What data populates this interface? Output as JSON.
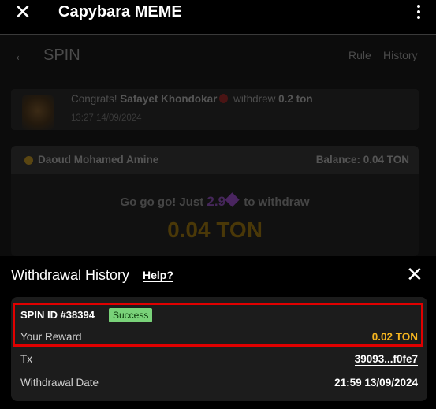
{
  "appbar": {
    "title": "Capybara MEME",
    "close_icon": "close-icon",
    "menu_icon": "more-vertical-icon"
  },
  "spin_page": {
    "title": "SPIN",
    "back_icon": "arrow-left-icon",
    "rule_label": "Rule",
    "history_label": "History",
    "congrats": {
      "prefix": "Congrats!",
      "name": "Safayet Khondokar",
      "emoji_icon": "strawberry-icon",
      "action": "withdrew",
      "amount": "0.2 ton",
      "timestamp": "13:27 14/09/2024"
    },
    "card": {
      "user_icon": "coin-icon",
      "user_name": "Daoud Mohamed Amine",
      "balance": "Balance: 0.04 TON",
      "message_prefix": "Go go go! Just",
      "message_number": "2.9",
      "gem_icon": "gem-icon",
      "message_suffix": "to withdraw",
      "amount": "0.04 TON"
    }
  },
  "sheet": {
    "title": "Withdrawal History",
    "help_label": "Help?",
    "close_icon": "close-icon",
    "record": {
      "spin_id": "SPIN ID #38394",
      "status": "Success",
      "reward_label": "Your Reward",
      "reward_value": "0.02 TON",
      "tx_label": "Tx",
      "tx_value": "39093...f0fe7",
      "date_label": "Withdrawal Date",
      "date_value": "21:59 13/09/2024"
    }
  },
  "colors": {
    "reward": "#f5b51f",
    "status_badge": "#79d279",
    "highlight_box": "#e00000"
  }
}
